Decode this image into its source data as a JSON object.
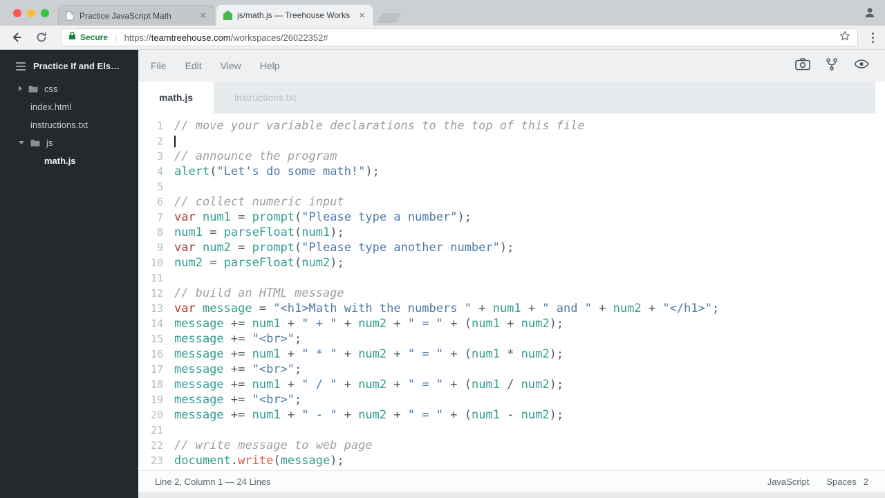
{
  "browser": {
    "tabs": [
      {
        "title": "Practice JavaScript Math",
        "close_label": "×",
        "active": false
      },
      {
        "title": "js/math.js — Treehouse Works",
        "close_label": "×",
        "active": true
      }
    ],
    "toolbar": {
      "secure_label": "Secure",
      "url_scheme": "https://",
      "url_host": "teamtreehouse.com",
      "url_path": "/workspaces/26022352#"
    }
  },
  "workspace": {
    "sidebar": {
      "project_title": "Practice If and Els…",
      "items": [
        {
          "label": "css",
          "type": "folder",
          "state": "collapsed",
          "indent": 0
        },
        {
          "label": "index.html",
          "type": "file",
          "indent": 0
        },
        {
          "label": "instructions.txt",
          "type": "file",
          "indent": 0
        },
        {
          "label": "js",
          "type": "folder",
          "state": "expanded",
          "indent": 0
        },
        {
          "label": "math.js",
          "type": "file",
          "indent": 1,
          "active": true
        }
      ]
    },
    "menu": {
      "items": [
        "File",
        "Edit",
        "View",
        "Help"
      ]
    },
    "editor_tabs": [
      {
        "label": "math.js",
        "active": true
      },
      {
        "label": "instructions.txt",
        "active": false
      }
    ],
    "status": {
      "position": "Line 2, Column 1 — 24 Lines",
      "language": "JavaScript",
      "indent_label": "Spaces",
      "indent_value": "2"
    },
    "code_lines": [
      {
        "n": "1",
        "tokens": [
          [
            "c",
            "// move your variable declarations to the top of this file"
          ]
        ]
      },
      {
        "n": "2",
        "cursor": true,
        "tokens": []
      },
      {
        "n": "3",
        "tokens": [
          [
            "c",
            "// announce the program"
          ]
        ]
      },
      {
        "n": "4",
        "tokens": [
          [
            "f",
            "alert"
          ],
          [
            "p",
            "("
          ],
          [
            "s",
            "\"Let's do some math!\""
          ],
          [
            "p",
            ");"
          ]
        ]
      },
      {
        "n": "5",
        "tokens": []
      },
      {
        "n": "6",
        "tokens": [
          [
            "c",
            "// collect numeric input"
          ]
        ]
      },
      {
        "n": "7",
        "tokens": [
          [
            "k",
            "var "
          ],
          [
            "v",
            "num1"
          ],
          [
            "p",
            " = "
          ],
          [
            "f",
            "prompt"
          ],
          [
            "p",
            "("
          ],
          [
            "s",
            "\"Please type a number\""
          ],
          [
            "p",
            ");"
          ]
        ]
      },
      {
        "n": "8",
        "tokens": [
          [
            "v",
            "num1"
          ],
          [
            "p",
            " = "
          ],
          [
            "f",
            "parseFloat"
          ],
          [
            "p",
            "("
          ],
          [
            "v",
            "num1"
          ],
          [
            "p",
            ");"
          ]
        ]
      },
      {
        "n": "9",
        "tokens": [
          [
            "k",
            "var "
          ],
          [
            "v",
            "num2"
          ],
          [
            "p",
            " = "
          ],
          [
            "f",
            "prompt"
          ],
          [
            "p",
            "("
          ],
          [
            "s",
            "\"Please type another number\""
          ],
          [
            "p",
            ");"
          ]
        ]
      },
      {
        "n": "10",
        "tokens": [
          [
            "v",
            "num2"
          ],
          [
            "p",
            " = "
          ],
          [
            "f",
            "parseFloat"
          ],
          [
            "p",
            "("
          ],
          [
            "v",
            "num2"
          ],
          [
            "p",
            ");"
          ]
        ]
      },
      {
        "n": "11",
        "tokens": []
      },
      {
        "n": "12",
        "tokens": [
          [
            "c",
            "// build an HTML message"
          ]
        ]
      },
      {
        "n": "13",
        "tokens": [
          [
            "k",
            "var "
          ],
          [
            "v",
            "message"
          ],
          [
            "p",
            " = "
          ],
          [
            "s",
            "\"<h1>Math with the numbers \""
          ],
          [
            "p",
            " + "
          ],
          [
            "v",
            "num1"
          ],
          [
            "p",
            " + "
          ],
          [
            "s",
            "\" and \""
          ],
          [
            "p",
            " + "
          ],
          [
            "v",
            "num2"
          ],
          [
            "p",
            " + "
          ],
          [
            "s",
            "\"</h1>\""
          ],
          [
            "p",
            ";"
          ]
        ]
      },
      {
        "n": "14",
        "tokens": [
          [
            "v",
            "message"
          ],
          [
            "p",
            " += "
          ],
          [
            "v",
            "num1"
          ],
          [
            "p",
            " + "
          ],
          [
            "s",
            "\" + \""
          ],
          [
            "p",
            " + "
          ],
          [
            "v",
            "num2"
          ],
          [
            "p",
            " + "
          ],
          [
            "s",
            "\" = \""
          ],
          [
            "p",
            " + ("
          ],
          [
            "v",
            "num1"
          ],
          [
            "p",
            " + "
          ],
          [
            "v",
            "num2"
          ],
          [
            "p",
            ");"
          ]
        ]
      },
      {
        "n": "15",
        "tokens": [
          [
            "v",
            "message"
          ],
          [
            "p",
            " += "
          ],
          [
            "s",
            "\"<br>\""
          ],
          [
            "p",
            ";"
          ]
        ]
      },
      {
        "n": "16",
        "tokens": [
          [
            "v",
            "message"
          ],
          [
            "p",
            " += "
          ],
          [
            "v",
            "num1"
          ],
          [
            "p",
            " + "
          ],
          [
            "s",
            "\" * \""
          ],
          [
            "p",
            " + "
          ],
          [
            "v",
            "num2"
          ],
          [
            "p",
            " + "
          ],
          [
            "s",
            "\" = \""
          ],
          [
            "p",
            " + ("
          ],
          [
            "v",
            "num1"
          ],
          [
            "p",
            " * "
          ],
          [
            "v",
            "num2"
          ],
          [
            "p",
            ");"
          ]
        ]
      },
      {
        "n": "17",
        "tokens": [
          [
            "v",
            "message"
          ],
          [
            "p",
            " += "
          ],
          [
            "s",
            "\"<br>\""
          ],
          [
            "p",
            ";"
          ]
        ]
      },
      {
        "n": "18",
        "tokens": [
          [
            "v",
            "message"
          ],
          [
            "p",
            " += "
          ],
          [
            "v",
            "num1"
          ],
          [
            "p",
            " + "
          ],
          [
            "s",
            "\" / \""
          ],
          [
            "p",
            " + "
          ],
          [
            "v",
            "num2"
          ],
          [
            "p",
            " + "
          ],
          [
            "s",
            "\" = \""
          ],
          [
            "p",
            " + ("
          ],
          [
            "v",
            "num1"
          ],
          [
            "p",
            " / "
          ],
          [
            "v",
            "num2"
          ],
          [
            "p",
            ");"
          ]
        ]
      },
      {
        "n": "19",
        "tokens": [
          [
            "v",
            "message"
          ],
          [
            "p",
            " += "
          ],
          [
            "s",
            "\"<br>\""
          ],
          [
            "p",
            ";"
          ]
        ]
      },
      {
        "n": "20",
        "tokens": [
          [
            "v",
            "message"
          ],
          [
            "p",
            " += "
          ],
          [
            "v",
            "num1"
          ],
          [
            "p",
            " + "
          ],
          [
            "s",
            "\" - \""
          ],
          [
            "p",
            " + "
          ],
          [
            "v",
            "num2"
          ],
          [
            "p",
            " + "
          ],
          [
            "s",
            "\" = \""
          ],
          [
            "p",
            " + ("
          ],
          [
            "v",
            "num1"
          ],
          [
            "p",
            " - "
          ],
          [
            "v",
            "num2"
          ],
          [
            "p",
            ");"
          ]
        ]
      },
      {
        "n": "21",
        "tokens": []
      },
      {
        "n": "22",
        "tokens": [
          [
            "c",
            "// write message to web page"
          ]
        ]
      },
      {
        "n": "23",
        "tokens": [
          [
            "v",
            "document"
          ],
          [
            "p",
            "."
          ],
          [
            "w",
            "write"
          ],
          [
            "p",
            "("
          ],
          [
            "v",
            "message"
          ],
          [
            "p",
            ");"
          ]
        ]
      }
    ]
  },
  "colors": {
    "accent_teal": "#2f9c90",
    "keyword_red": "#b13a30",
    "string_blue": "#4d7ba6",
    "comment_gray": "#9aa0a6",
    "method_orange": "#e05a3f",
    "secure_green": "#188038",
    "treehouse_green": "#49b749"
  }
}
